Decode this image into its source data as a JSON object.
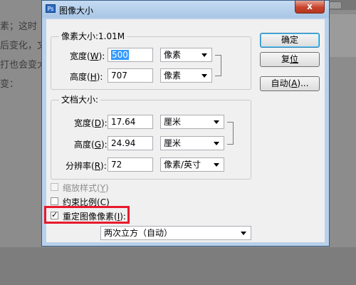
{
  "background": {
    "lines": [
      "素；这时",
      "后变化，文",
      "打也会变大",
      "变："
    ]
  },
  "dialog": {
    "title": "图像大小",
    "close_label": "x",
    "pixel_dims": {
      "legend": "像素大小:1.01M",
      "width": {
        "label": "宽度(",
        "key": "W",
        "suffix": "):",
        "value": "500",
        "unit": "像素"
      },
      "height": {
        "label": "高度(",
        "key": "H",
        "suffix": "):",
        "value": "707",
        "unit": "像素"
      }
    },
    "doc_size": {
      "legend": "文档大小:",
      "width": {
        "label": "宽度(",
        "key": "D",
        "suffix": "):",
        "value": "17.64",
        "unit": "厘米"
      },
      "height": {
        "label": "高度(",
        "key": "G",
        "suffix": "):",
        "value": "24.94",
        "unit": "厘米"
      },
      "resolution": {
        "label": "分辨率(",
        "key": "R",
        "suffix": "):",
        "value": "72",
        "unit": "像素/英寸"
      }
    },
    "buttons": {
      "ok": "确定",
      "reset_pre": "复",
      "reset_key": "位",
      "auto_pre": "自动(",
      "auto_key": "A",
      "auto_post": ")..."
    },
    "options": {
      "scale_styles": {
        "label": "缩放样式(",
        "key": "Y",
        "suffix": ")",
        "checked": false,
        "enabled": false
      },
      "constrain": {
        "label": "约束比例(",
        "key": "C",
        "suffix": ")",
        "checked": false,
        "enabled": true
      },
      "resample": {
        "label": "重定图像像素(",
        "key": "I",
        "suffix": "):",
        "checked": true,
        "enabled": true
      },
      "check_glyph": "✓",
      "resample_method": "两次立方（自动）"
    }
  }
}
